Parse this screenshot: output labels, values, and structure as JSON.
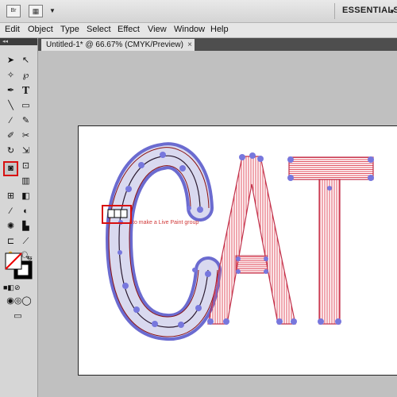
{
  "appbar": {
    "br_label": "Br",
    "workspace": "ESSENTIALS"
  },
  "menu": [
    "Edit",
    "Object",
    "Type",
    "Select",
    "Effect",
    "View",
    "Window",
    "Help"
  ],
  "document": {
    "tab_title": "Untitled-1* @ 66.67% (CMYK/Preview)",
    "close_glyph": "×"
  },
  "canvas": {
    "art_text": "CAT",
    "tooltip": "to make a Live Paint group"
  },
  "tools": [
    "selection-tool",
    "direct-selection-tool",
    "magic-wand-tool",
    "lasso-tool",
    "pen-tool",
    "type-tool",
    "line-segment-tool",
    "rectangle-tool",
    "paintbrush-tool",
    "pencil-tool",
    "blob-brush-tool",
    "scissors-tool",
    "rotate-tool",
    "scale-tool",
    "width-tool",
    "free-transform-tool",
    "live-paint-bucket-tool",
    "perspective-grid-tool",
    "mesh-tool",
    "gradient-tool",
    "eyedropper-tool",
    "blend-tool",
    "symbol-sprayer-tool",
    "column-graph-tool",
    "artboard-tool",
    "slice-tool",
    "hand-tool",
    "zoom-tool"
  ]
}
